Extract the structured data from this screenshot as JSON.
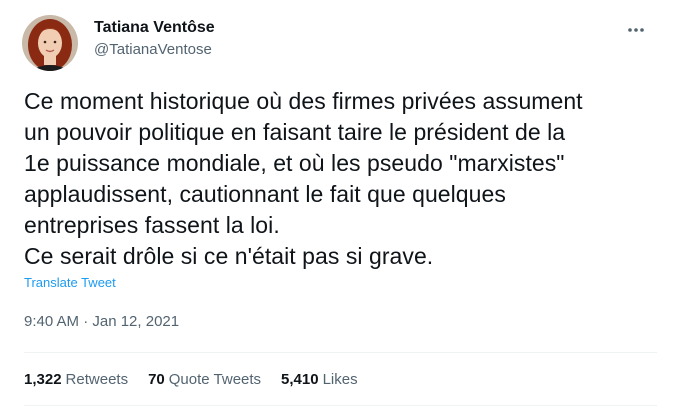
{
  "author": {
    "name": "Tatiana Ventôse",
    "handle": "@TatianaVentose",
    "avatar_icon": "avatar-portrait"
  },
  "menu": {
    "more_icon": "more-icon"
  },
  "tweet": {
    "text": "Ce moment historique où des firmes privées assument\nun pouvoir politique en faisant taire le président de la\n1e puissance mondiale, et où les pseudo \"marxistes\"\napplaudissent, cautionnant le fait que quelques\nentreprises fassent la loi.\nCe serait drôle si ce n'était pas si grave.",
    "translate_label": "Translate Tweet",
    "timestamp": "9:40 AM · Jan 12, 2021"
  },
  "stats": {
    "retweets_count": "1,322",
    "retweets_label": "Retweets",
    "quotes_count": "70",
    "quotes_label": "Quote Tweets",
    "likes_count": "5,410",
    "likes_label": "Likes"
  },
  "colors": {
    "text_primary": "#0f1419",
    "text_secondary": "#536471",
    "link": "#1d9bf0",
    "divider": "#eff3f4"
  }
}
